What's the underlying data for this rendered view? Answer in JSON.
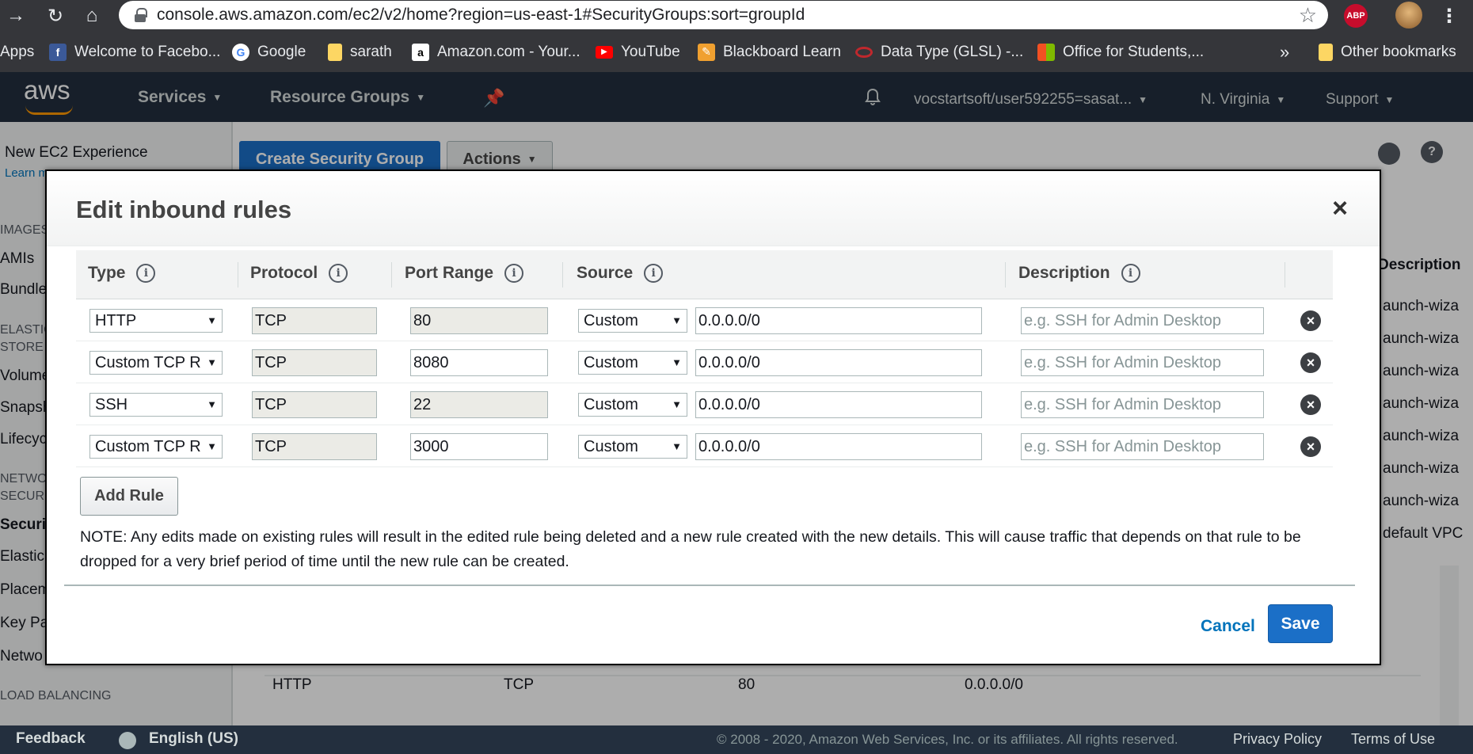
{
  "browser": {
    "url": "console.aws.amazon.com/ec2/v2/home?region=us-east-1#SecurityGroups:sort=groupId",
    "extension_badge": "ABP",
    "bookmarks": [
      "Apps",
      "Welcome to Facebo...",
      "Google",
      "sarath",
      "Amazon.com - Your...",
      "YouTube",
      "Blackboard Learn",
      "Data Type (GLSL) -...",
      "Office for Students,...",
      "Other bookmarks"
    ],
    "bookmarks_overflow": "»"
  },
  "aws_nav": {
    "logo": "aws",
    "services": "Services",
    "resource_groups": "Resource Groups",
    "account": "vocstartsoft/user592255=sasat...",
    "region": "N. Virginia",
    "support": "Support"
  },
  "background": {
    "new_experience": "New EC2 Experience",
    "learn_more": "Learn m",
    "create_button": "Create Security Group",
    "actions_button": "Actions",
    "sidebar_items": [
      "IMAGES",
      "AMIs",
      "Bundle",
      "ELASTIC",
      "STORE",
      "Volume",
      "Snapsh",
      "Lifecyc",
      "NETWO",
      "SECURI",
      "Securi",
      "Elastic",
      "Placem",
      "Key Pa",
      "Netwo",
      "LOAD BALANCING"
    ],
    "right_column_header": "Description",
    "right_column_values": [
      "aunch-wiza",
      "aunch-wiza",
      "aunch-wiza",
      "aunch-wiza",
      "aunch-wiza",
      "aunch-wiza",
      "aunch-wiza",
      "default VPC"
    ],
    "detail_row": {
      "type": "HTTP",
      "protocol": "TCP",
      "port": "80",
      "source": "0.0.0.0/0"
    }
  },
  "modal": {
    "title": "Edit inbound rules",
    "close": "×",
    "columns": {
      "type": "Type",
      "protocol": "Protocol",
      "port_range": "Port Range",
      "source": "Source",
      "description": "Description"
    },
    "rules": [
      {
        "type": "HTTP",
        "protocol": "TCP",
        "port": "80",
        "port_readonly": true,
        "source_type": "Custom",
        "source": "0.0.0.0/0",
        "description_placeholder": "e.g. SSH for Admin Desktop"
      },
      {
        "type": "Custom TCP R",
        "protocol": "TCP",
        "port": "8080",
        "port_readonly": false,
        "source_type": "Custom",
        "source": "0.0.0.0/0",
        "description_placeholder": "e.g. SSH for Admin Desktop"
      },
      {
        "type": "SSH",
        "protocol": "TCP",
        "port": "22",
        "port_readonly": true,
        "source_type": "Custom",
        "source": "0.0.0.0/0",
        "description_placeholder": "e.g. SSH for Admin Desktop"
      },
      {
        "type": "Custom TCP R",
        "protocol": "TCP",
        "port": "3000",
        "port_readonly": false,
        "source_type": "Custom",
        "source": "0.0.0.0/0",
        "description_placeholder": "e.g. SSH for Admin Desktop"
      }
    ],
    "add_rule": "Add Rule",
    "note": "NOTE: Any edits made on existing rules will result in the edited rule being deleted and a new rule created with the new details. This will cause traffic that depends on that rule to be dropped for a very brief period of time until the new rule can be created.",
    "cancel": "Cancel",
    "save": "Save"
  },
  "footer": {
    "feedback": "Feedback",
    "language": "English (US)",
    "copyright": "© 2008 - 2020, Amazon Web Services, Inc. or its affiliates. All rights reserved.",
    "privacy": "Privacy Policy",
    "terms": "Terms of Use"
  },
  "colors": {
    "aws_nav": "#232f3e",
    "primary": "#1b6fc7",
    "link": "#0073bb",
    "orange": "#ff9900"
  }
}
